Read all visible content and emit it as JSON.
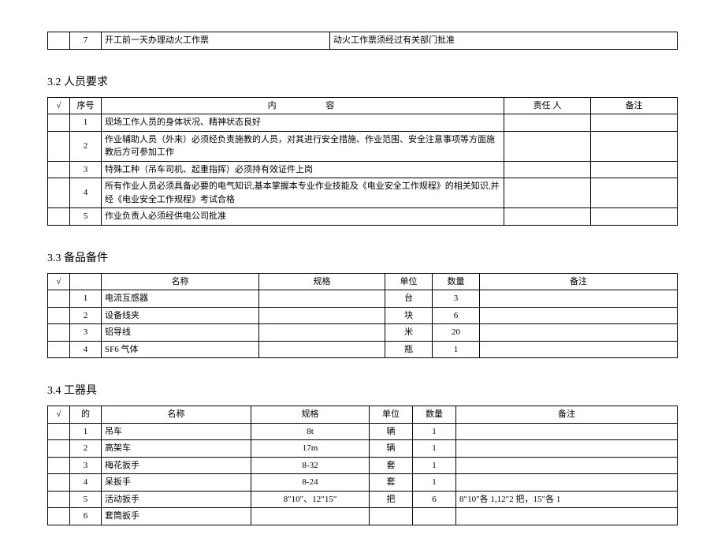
{
  "table1": {
    "rows": [
      {
        "num": "7",
        "left": "开工前一天办理动火工作票",
        "right": "动火工作票须经过有关部门批准"
      }
    ]
  },
  "heading2": "3.2 人员要求",
  "table2": {
    "headers": {
      "check": "√",
      "num": "序号",
      "content": "内 容",
      "person": "责任 人",
      "note": "备注"
    },
    "rows": [
      {
        "num": "1",
        "content": "现场工作人员的身体状况、精神状态良好",
        "person": "",
        "note": ""
      },
      {
        "num": "2",
        "content": "作业辅助人员（外来）必须经负责施教的人员，对其进行安全措施、作业范围、安全注意事项等方面施教后方可参加工作",
        "person": "",
        "note": ""
      },
      {
        "num": "3",
        "content": "特殊工种（吊车司机、起重指挥）必须持有效证件上岗",
        "person": "",
        "note": ""
      },
      {
        "num": "4",
        "content": "所有作业人员必须具备必要的电气知识,基本掌握本专业作业技能及《电业安全工作规程》的相关知识,并经《电业安全工作规程》考试合格",
        "person": "",
        "note": ""
      },
      {
        "num": "5",
        "content": "作业负责人必须经供电公司批准",
        "person": "",
        "note": ""
      }
    ]
  },
  "heading3": "3.3 备品备件",
  "table3": {
    "headers": {
      "check": "√",
      "num": "",
      "name": "名称",
      "spec": "规格",
      "unit": "单位",
      "qty": "数量",
      "note": "备注"
    },
    "rows": [
      {
        "num": "1",
        "name": "电流互感器",
        "spec": "",
        "unit": "台",
        "qty": "3",
        "note": ""
      },
      {
        "num": "2",
        "name": "设备线夹",
        "spec": "",
        "unit": "块",
        "qty": "6",
        "note": ""
      },
      {
        "num": "3",
        "name": "铝导线",
        "spec": "",
        "unit": "米",
        "qty": "20",
        "note": ""
      },
      {
        "num": "4",
        "name": "SF6 气体",
        "spec": "",
        "unit": "瓶",
        "qty": "1",
        "note": ""
      }
    ]
  },
  "heading4": "3.4 工器具",
  "table4": {
    "headers": {
      "check": "√",
      "num": "的",
      "name": "名称",
      "spec": "规格",
      "unit": "单位",
      "qty": "数量",
      "note": "备注"
    },
    "rows": [
      {
        "num": "1",
        "name": "吊车",
        "spec": "8t",
        "unit": "辆",
        "qty": "1",
        "note": ""
      },
      {
        "num": "2",
        "name": "高架车",
        "spec": "17m",
        "unit": "辆",
        "qty": "1",
        "note": ""
      },
      {
        "num": "3",
        "name": "梅花扳手",
        "spec": "8-32",
        "unit": "套",
        "qty": "1",
        "note": ""
      },
      {
        "num": "4",
        "name": "呆扳手",
        "spec": "8-24",
        "unit": "套",
        "qty": "1",
        "note": ""
      },
      {
        "num": "5",
        "name": "活动扳手",
        "spec": "8″10″、12″15″",
        "unit": "把",
        "qty": "6",
        "note": "8″10″各 1,12″2 把，15″各 1"
      },
      {
        "num": "6",
        "name": "套筒扳手",
        "spec": "",
        "unit": "",
        "qty": "",
        "note": ""
      }
    ]
  }
}
